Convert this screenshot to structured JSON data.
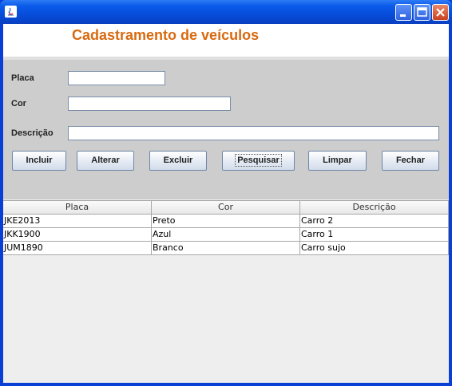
{
  "window": {
    "title": "",
    "colors": {
      "titlebar": "#0A5BEA",
      "header_text": "#D86A10",
      "form_bg": "#CDCDCD"
    }
  },
  "header": {
    "title": "Cadastramento de veículos"
  },
  "form": {
    "placa_label": "Placa",
    "cor_label": "Cor",
    "descricao_label": "Descrição",
    "placa_value": "",
    "cor_value": "",
    "descricao_value": ""
  },
  "buttons": {
    "incluir": "Incluir",
    "alterar": "Alterar",
    "excluir": "Excluir",
    "pesquisar": "Pesquisar",
    "limpar": "Limpar",
    "fechar": "Fechar"
  },
  "table": {
    "columns": [
      "Placa",
      "Cor",
      "Descrição"
    ],
    "rows": [
      [
        "JKE2013",
        "Preto",
        "Carro 2"
      ],
      [
        "JKK1900",
        "Azul",
        "Carro 1"
      ],
      [
        "JUM1890",
        "Branco",
        "Carro sujo"
      ]
    ]
  }
}
